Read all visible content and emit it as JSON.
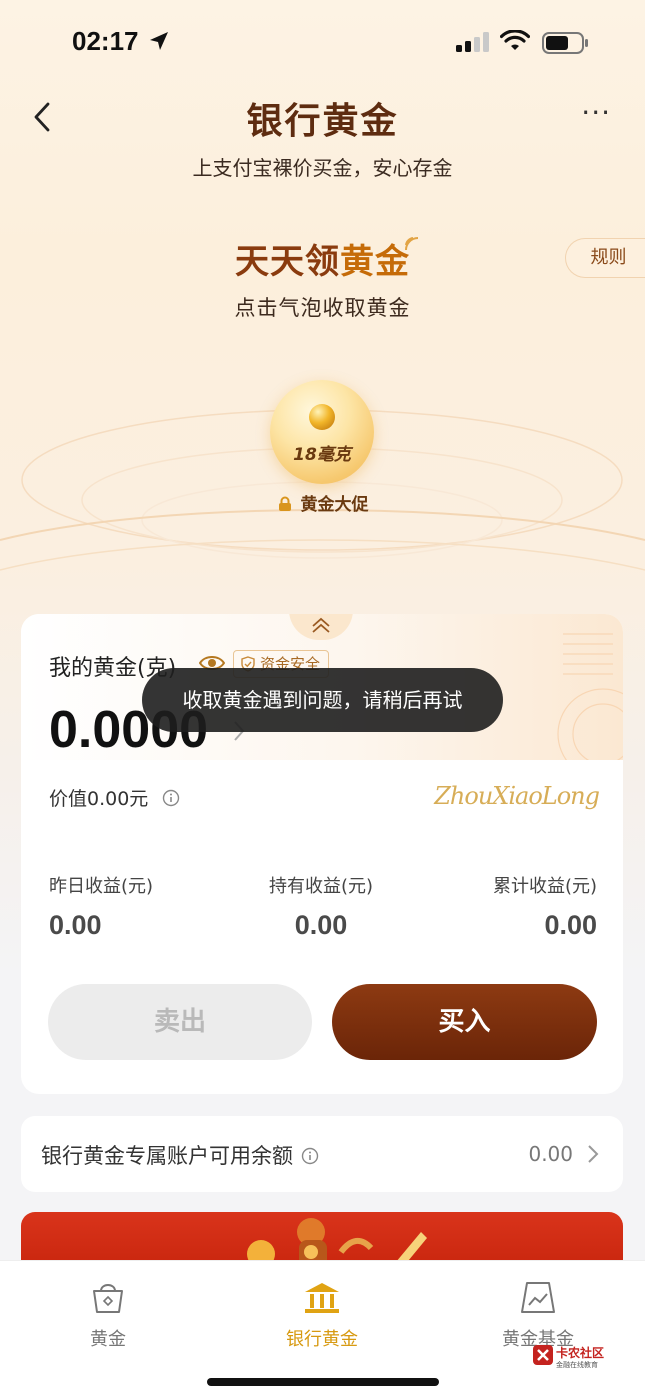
{
  "status_bar": {
    "time": "02:17"
  },
  "header": {
    "title": "银行黄金",
    "subtitle": "上支付宝裸价买金，安心存金",
    "more_label": "···"
  },
  "daily": {
    "title_part1": "天天领",
    "title_part2": "黄金",
    "subtitle": "点击气泡收取黄金",
    "rules_label": "规则",
    "bubble_amount": "18毫克",
    "promo_label": "黄金大促"
  },
  "card": {
    "my_gold_label": "我的黄金(克)",
    "safe_badge": "资金安全",
    "gold_amount": "0.0000",
    "value_text": "价值0.00元",
    "signature": "ZhouXiaoLong",
    "stats": [
      {
        "label": "昨日收益(元)",
        "value": "0.00"
      },
      {
        "label": "持有收益(元)",
        "value": "0.00"
      },
      {
        "label": "累计收益(元)",
        "value": "0.00"
      }
    ],
    "sell_label": "卖出",
    "buy_label": "买入"
  },
  "toast": {
    "message": "收取黄金遇到问题，请稍后再试"
  },
  "balance": {
    "label": "银行黄金专属账户可用余额",
    "value": "0.00"
  },
  "tabs": [
    {
      "label": "黄金",
      "icon": "bag-icon",
      "active": false
    },
    {
      "label": "银行黄金",
      "icon": "bank-icon",
      "active": true
    },
    {
      "label": "黄金基金",
      "icon": "chart-icon",
      "active": false
    }
  ],
  "watermark": {
    "brand": "卡农社区",
    "sub": "金融在线教育"
  },
  "colors": {
    "brand_brown": "#6b2508",
    "gold": "#d79a12",
    "accent_text": "#5e2c10"
  }
}
